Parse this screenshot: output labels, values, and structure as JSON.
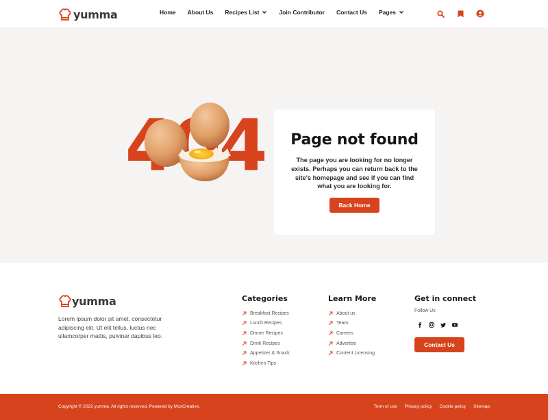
{
  "brand": {
    "name": "yumma"
  },
  "nav": {
    "items": [
      {
        "label": "Home"
      },
      {
        "label": "About Us"
      },
      {
        "label": "Recipes List"
      },
      {
        "label": "Join Contributor"
      },
      {
        "label": "Contact Us"
      },
      {
        "label": "Pages"
      }
    ]
  },
  "hero": {
    "art_text": "404",
    "title": "Page not found",
    "message": "The page you are looking for no longer exists. Perhaps you can return back to the site's homepage and see if you can find what you are looking for.",
    "button": "Back Home"
  },
  "footer": {
    "description": "Lorem ipsum dolor sit amet, consectetur adipiscing elit. Ut elit tellus, luctus nec ullamcorper mattis, pulvinar dapibus leo.",
    "categories": {
      "title": "Categories",
      "items": [
        "Breakfast Recipes",
        "Lunch Recipes",
        "Dinner Recipes",
        "Drink Recipes",
        "Appetizer & Snack",
        "Kitchen Tips"
      ]
    },
    "learn_more": {
      "title": "Learn More",
      "items": [
        "About us",
        "Team",
        "Careers",
        "Advertise",
        "Content Licensing"
      ]
    },
    "connect": {
      "title": "Get in connect",
      "follow": "Follow Us",
      "socials": [
        "facebook-icon",
        "instagram-icon",
        "twitter-icon",
        "youtube-icon"
      ],
      "button": "Contact Us"
    },
    "copyright": "Copyright © 2022 yumma, All rights reserved. Powered by MoxCreative.",
    "legal": [
      "Term of use",
      "Privacy policy",
      "Cookie policy",
      "Sitemap"
    ]
  },
  "colors": {
    "accent": "#d6431c",
    "hero_bg": "#f5f4f2",
    "text": "#1e1e1e"
  }
}
